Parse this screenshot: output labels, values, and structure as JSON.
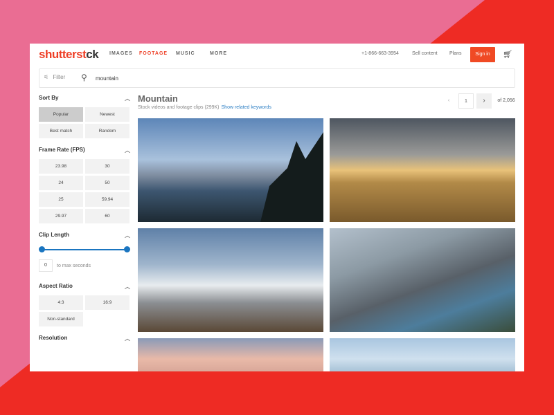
{
  "nav": {
    "logo": "shutterstock",
    "logo_a": "shutterst",
    "logo_b": "ck",
    "items": [
      "IMAGES",
      "FOOTAGE",
      "MUSIC",
      "MORE"
    ],
    "active": "FOOTAGE",
    "phone": "+1-866-663-3954",
    "sell": "Sell content",
    "plans": "Plans",
    "signin": "Sign in"
  },
  "search": {
    "filter_label": "Filter",
    "value": "mountain"
  },
  "sidebar": {
    "sort_by": {
      "title": "Sort By",
      "options": [
        "Popular",
        "Newest",
        "Best match",
        "Random"
      ],
      "selected": "Popular"
    },
    "frame_rate": {
      "title": "Frame Rate (FPS)",
      "options": [
        "23.98",
        "30",
        "24",
        "50",
        "25",
        "59.94",
        "29.97",
        "60"
      ]
    },
    "clip_length": {
      "title": "Clip Length",
      "min_value": "0",
      "max_label": "to max seconds"
    },
    "aspect_ratio": {
      "title": "Aspect Ratio",
      "options": [
        "4:3",
        "16:9",
        "Non-standard"
      ]
    },
    "resolution": {
      "title": "Resolution"
    }
  },
  "results": {
    "title": "Mountain",
    "subtitle": "Stock videos and footage clips (299K)",
    "related_link": "Show related keywords",
    "page": "1",
    "of_pages": "of 2,056"
  },
  "colors": {
    "accent": "#ee3f26",
    "link": "#2d7fc4"
  }
}
